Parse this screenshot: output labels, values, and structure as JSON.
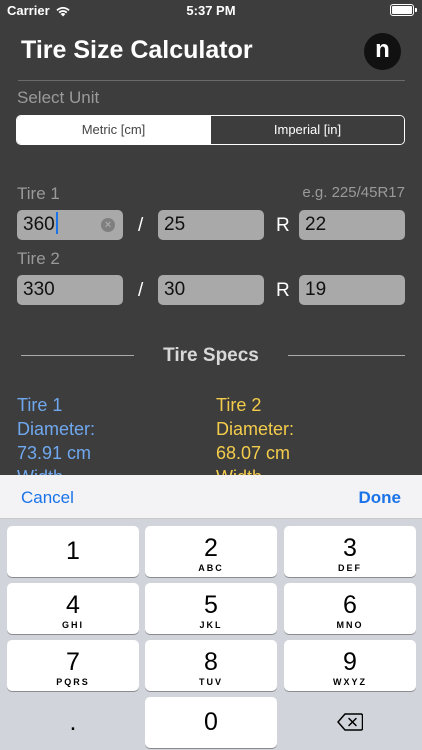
{
  "status": {
    "carrier": "Carrier",
    "time": "5:37 PM"
  },
  "header": {
    "title": "Tire Size Calculator",
    "logo": "n"
  },
  "unit": {
    "label": "Select Unit",
    "options": [
      "Metric [cm]",
      "Imperial [in]"
    ],
    "selected": 0
  },
  "tire1": {
    "label": "Tire 1",
    "example": "e.g. 225/45R17",
    "width": "360",
    "ratio": "25",
    "rim": "22"
  },
  "tire2": {
    "label": "Tire 2",
    "width": "330",
    "ratio": "30",
    "rim": "19"
  },
  "separators": {
    "slash": "/",
    "r": "R"
  },
  "specs": {
    "title": "Tire Specs",
    "tire1": {
      "name": "Tire 1",
      "diameter_label": "Diameter:",
      "diameter_value": "73.91 cm",
      "width_label": "Width"
    },
    "tire2": {
      "name": "Tire 2",
      "diameter_label": "Diameter:",
      "diameter_value": "68.07 cm",
      "width_label": "Width"
    }
  },
  "keyboard": {
    "cancel": "Cancel",
    "done": "Done",
    "keys": [
      {
        "num": "1",
        "letters": ""
      },
      {
        "num": "2",
        "letters": "ABC"
      },
      {
        "num": "3",
        "letters": "DEF"
      },
      {
        "num": "4",
        "letters": "GHI"
      },
      {
        "num": "5",
        "letters": "JKL"
      },
      {
        "num": "6",
        "letters": "MNO"
      },
      {
        "num": "7",
        "letters": "PQRS"
      },
      {
        "num": "8",
        "letters": "TUV"
      },
      {
        "num": "9",
        "letters": "WXYZ"
      }
    ],
    "dot": ".",
    "zero": "0"
  },
  "colors": {
    "background": "#3d3d3d",
    "field": "#a9a9a9",
    "tire1_accent": "#6fa8ef",
    "tire2_accent": "#f4cc4b",
    "link": "#1a73e8"
  },
  "icons": {
    "wifi": "wifi-icon",
    "battery": "battery-icon",
    "clear": "clear-icon",
    "backspace": "backspace-icon"
  }
}
